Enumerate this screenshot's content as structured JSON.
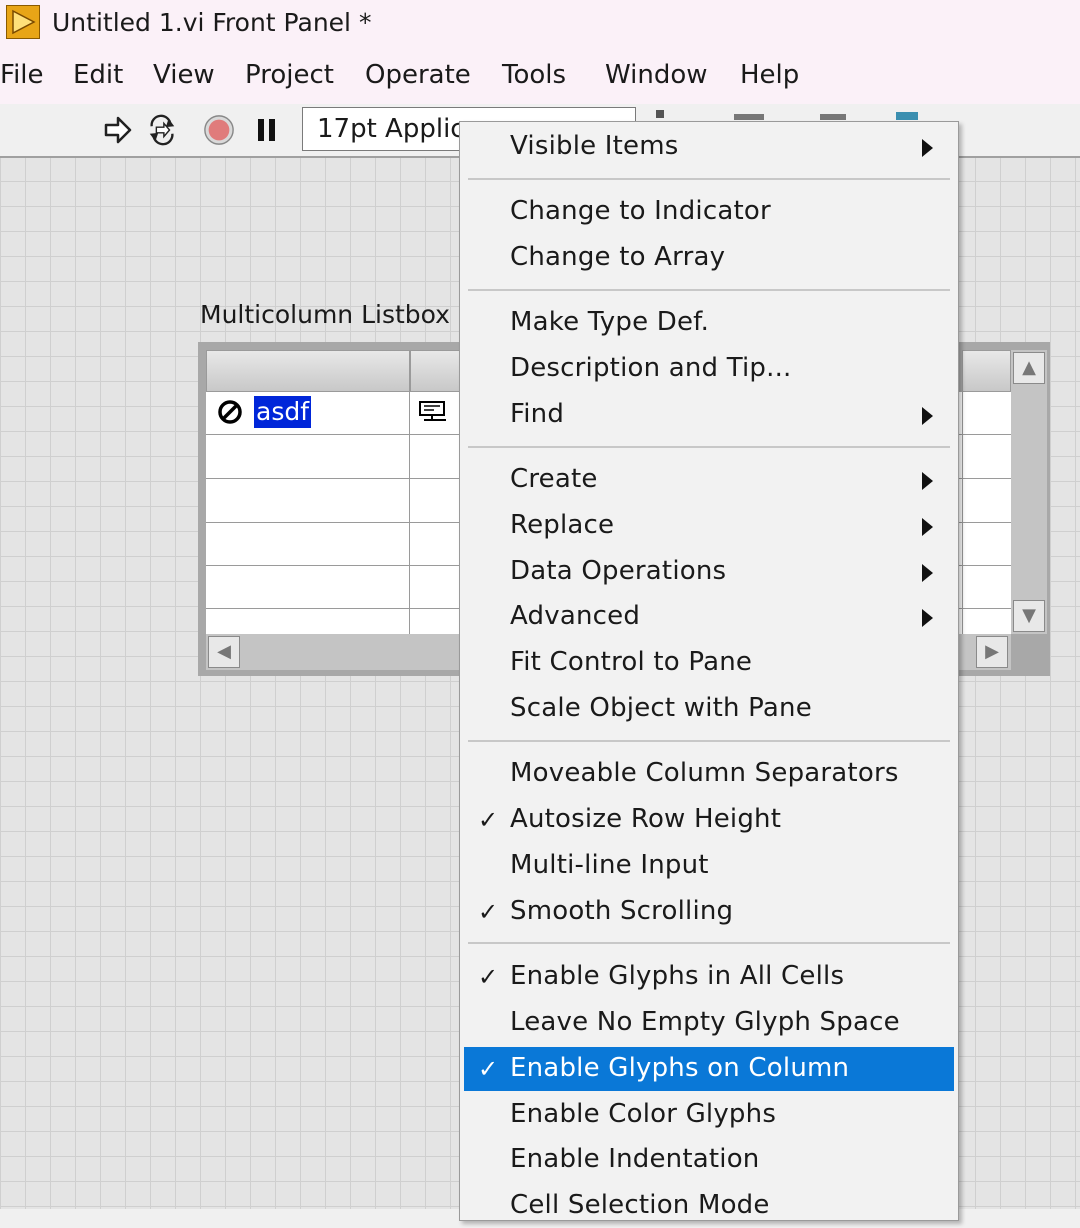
{
  "window": {
    "title": "Untitled 1.vi Front Panel *"
  },
  "menubar": {
    "items": [
      {
        "label": "File"
      },
      {
        "label": "Edit"
      },
      {
        "label": "View"
      },
      {
        "label": "Project"
      },
      {
        "label": "Operate"
      },
      {
        "label": "Tools"
      },
      {
        "label": "Window"
      },
      {
        "label": "Help"
      }
    ]
  },
  "toolbar": {
    "font_selector_value": "17pt Applic",
    "icons": [
      "run-arrow-icon",
      "run-continuously-icon",
      "abort-icon",
      "pause-icon"
    ]
  },
  "listbox": {
    "label": "Multicolumn Listbox",
    "cell_value": "asdf"
  },
  "context_menu": {
    "items": [
      {
        "label": "Visible Items",
        "submenu": true
      },
      {
        "label": "Change to Indicator"
      },
      {
        "label": "Change to Array"
      },
      {
        "label": "Make Type Def."
      },
      {
        "label": "Description and Tip..."
      },
      {
        "label": "Find",
        "submenu": true
      },
      {
        "label": "Create",
        "submenu": true
      },
      {
        "label": "Replace",
        "submenu": true
      },
      {
        "label": "Data Operations",
        "submenu": true
      },
      {
        "label": "Advanced",
        "submenu": true
      },
      {
        "label": "Fit Control to Pane"
      },
      {
        "label": "Scale Object with Pane"
      },
      {
        "label": "Moveable Column Separators"
      },
      {
        "label": "Autosize Row Height",
        "checked": true
      },
      {
        "label": "Multi-line Input"
      },
      {
        "label": "Smooth Scrolling",
        "checked": true
      },
      {
        "label": "Enable Glyphs in All Cells",
        "checked": true
      },
      {
        "label": "Leave No Empty Glyph Space"
      },
      {
        "label": "Enable Glyphs on Column",
        "checked": true,
        "highlighted": true
      },
      {
        "label": "Enable Color Glyphs"
      },
      {
        "label": "Enable Indentation"
      },
      {
        "label": "Cell Selection Mode"
      }
    ],
    "check_mark": "✓",
    "highlight_color": "#0a78d7"
  }
}
